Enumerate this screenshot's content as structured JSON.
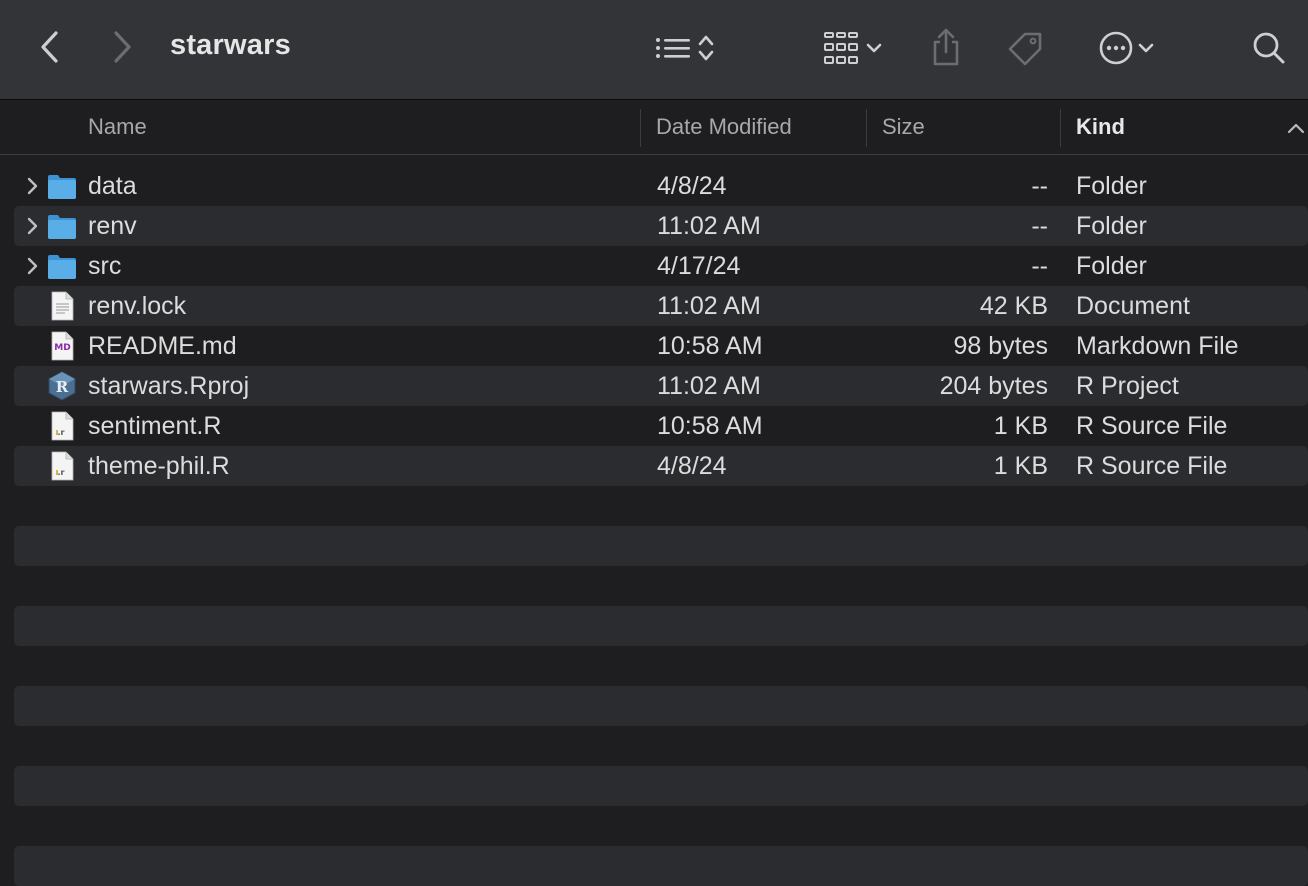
{
  "toolbar": {
    "title": "starwars",
    "icons": [
      "back-icon",
      "forward-icon",
      "list-view-icon",
      "sort-updown-icon",
      "grid-view-icon",
      "chevron-down-icon",
      "share-icon",
      "tag-icon",
      "more-icon",
      "search-icon"
    ]
  },
  "columns": {
    "name": "Name",
    "date": "Date Modified",
    "size": "Size",
    "kind": "Kind"
  },
  "files": [
    {
      "name": "data",
      "date": "4/8/24",
      "size": "--",
      "kind": "Folder",
      "icon": "folder-icon",
      "expandable": true
    },
    {
      "name": "renv",
      "date": "11:02 AM",
      "size": "--",
      "kind": "Folder",
      "icon": "folder-icon",
      "expandable": true
    },
    {
      "name": "src",
      "date": "4/17/24",
      "size": "--",
      "kind": "Folder",
      "icon": "folder-icon",
      "expandable": true
    },
    {
      "name": "renv.lock",
      "date": "11:02 AM",
      "size": "42 KB",
      "kind": "Document",
      "icon": "document-icon",
      "expandable": false
    },
    {
      "name": "README.md",
      "date": "10:58 AM",
      "size": "98 bytes",
      "kind": "Markdown File",
      "icon": "markdown-file-icon",
      "expandable": false
    },
    {
      "name": "starwars.Rproj",
      "date": "11:02 AM",
      "size": "204 bytes",
      "kind": "R Project",
      "icon": "r-project-icon",
      "expandable": false
    },
    {
      "name": "sentiment.R",
      "date": "10:58 AM",
      "size": "1 KB",
      "kind": "R Source File",
      "icon": "r-source-icon",
      "expandable": false
    },
    {
      "name": "theme-phil.R",
      "date": "4/8/24",
      "size": "1 KB",
      "kind": "R Source File",
      "icon": "r-source-icon",
      "expandable": false
    }
  ],
  "colors": {
    "background": "#1e1e20",
    "toolbar": "#333437",
    "stripe": "#2b2c2f",
    "folder": "#5aaee8"
  }
}
